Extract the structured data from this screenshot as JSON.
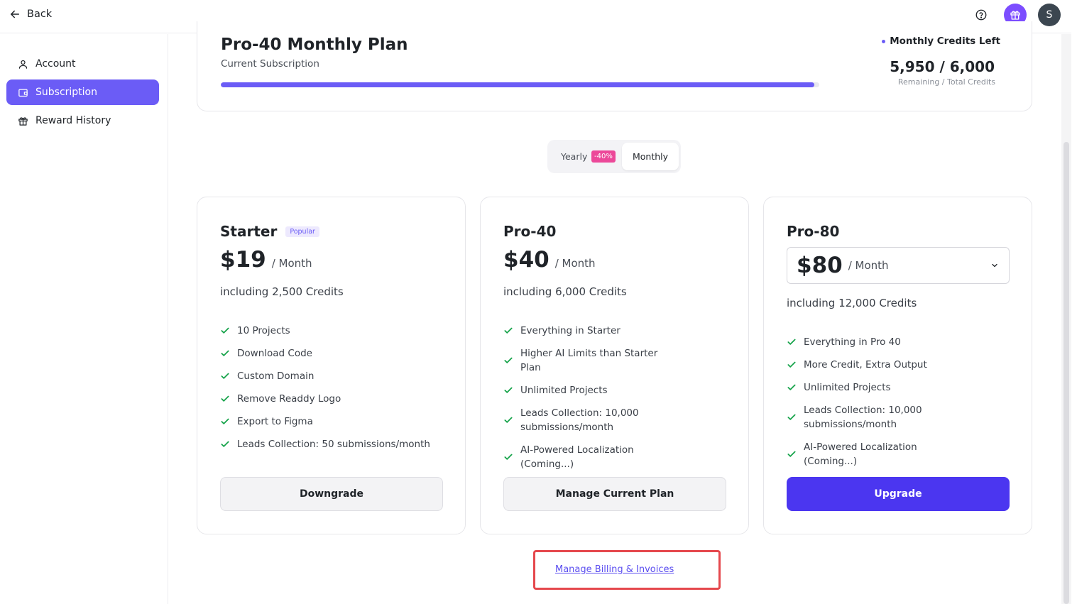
{
  "topbar": {
    "back_label": "Back",
    "avatar_initial": "S"
  },
  "sidebar": {
    "items": [
      {
        "label": "Account",
        "icon": "user-icon",
        "active": false
      },
      {
        "label": "Subscription",
        "icon": "wallet-icon",
        "active": true
      },
      {
        "label": "Reward History",
        "icon": "gift-icon",
        "active": false
      }
    ]
  },
  "current_plan": {
    "title": "Pro-40 Monthly Plan",
    "subtitle": "Current Subscription",
    "credits_label": "Monthly Credits Left",
    "credits_value": "5,950 / 6,000",
    "credits_caption": "Remaining / Total Credits",
    "progress_fraction": 0.992
  },
  "billing_toggle": {
    "yearly": "Yearly",
    "discount": "-40%",
    "monthly": "Monthly",
    "selected": "Monthly"
  },
  "plans": [
    {
      "name": "Starter",
      "badge": "Popular",
      "price": "$19",
      "per": "/ Month",
      "includes": "including 2,500 Credits",
      "features": [
        "10 Projects",
        "Download Code",
        "Custom Domain",
        "Remove Readdy Logo",
        "Export to Figma",
        "Leads Collection: 50 submissions/month"
      ],
      "button": "Downgrade"
    },
    {
      "name": "Pro-40",
      "price": "$40",
      "per": "/ Month",
      "includes": "including 6,000 Credits",
      "features": [
        "Everything in Starter",
        "Higher AI Limits than Starter Plan",
        "Unlimited Projects",
        "Leads Collection: 10,000 submissions/month",
        "AI-Powered Localization (Coming...)"
      ],
      "button": "Manage Current Plan"
    },
    {
      "name": "Pro-80",
      "price": "$80",
      "per": "/ Month",
      "includes": "including 12,000 Credits",
      "features": [
        "Everything in Pro 40",
        "More Credit, Extra Output",
        "Unlimited Projects",
        "Leads Collection: 10,000 submissions/month",
        "AI-Powered Localization (Coming...)"
      ],
      "button": "Upgrade"
    }
  ],
  "billing_link": "Manage Billing & Invoices",
  "colors": {
    "accent": "#6b5cf6",
    "primary_button": "#4b36f0",
    "check": "#16a34a",
    "badge": "#ec4899",
    "highlight": "#e5484d"
  }
}
